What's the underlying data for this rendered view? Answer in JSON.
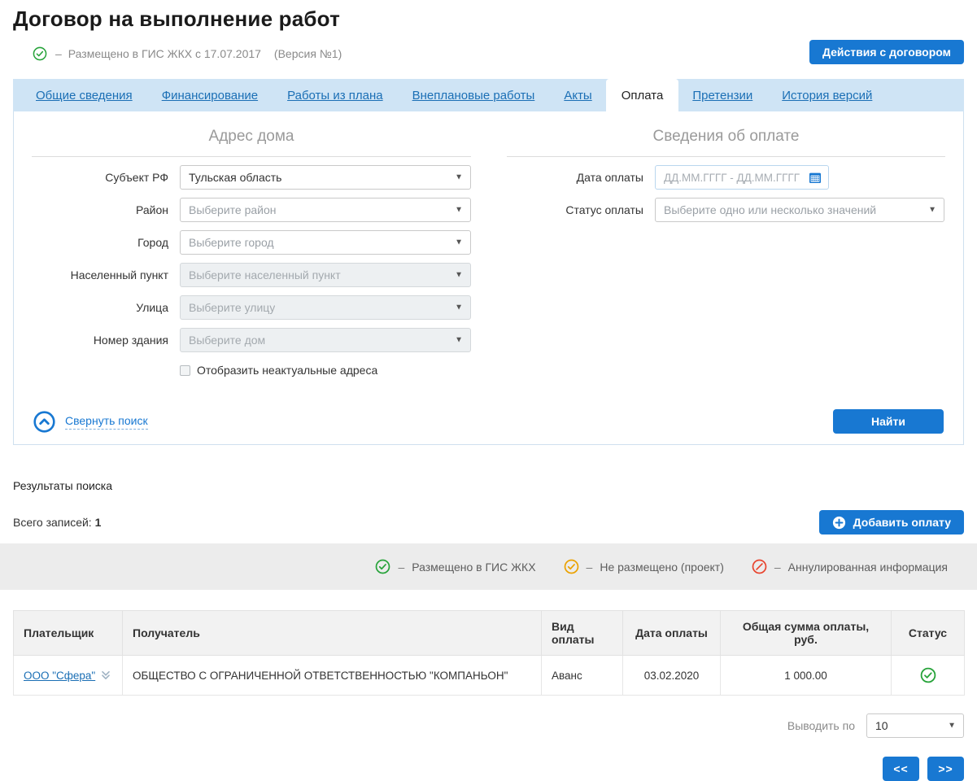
{
  "colors": {
    "accent": "#1878d2",
    "green": "#27a33a",
    "orange": "#eba200",
    "red": "#e8442e"
  },
  "page": {
    "title": "Договор на выполнение работ",
    "status_dash": "–",
    "status_text": "Размещено в ГИС ЖКХ с 17.07.2017",
    "version_text": "(Версия №1)",
    "actions_button": "Действия с договором"
  },
  "tabs": [
    {
      "label": "Общие сведения"
    },
    {
      "label": "Финансирование"
    },
    {
      "label": "Работы из плана"
    },
    {
      "label": "Внеплановые работы"
    },
    {
      "label": "Акты"
    },
    {
      "label": "Оплата",
      "active": true
    },
    {
      "label": "Претензии"
    },
    {
      "label": "История версий"
    }
  ],
  "search": {
    "address_section_title": "Адрес дома",
    "payment_section_title": "Сведения об оплате",
    "address_fields": [
      {
        "label": "Субъект РФ",
        "text": "Тульская область"
      },
      {
        "label": "Район",
        "text": "Выберите район"
      },
      {
        "label": "Город",
        "text": "Выберите город"
      },
      {
        "label": "Населенный пункт",
        "text": "Выберите населенный пункт"
      },
      {
        "label": "Улица",
        "text": "Выберите улицу"
      },
      {
        "label": "Номер здания",
        "text": "Выберите дом"
      }
    ],
    "checkbox_label": "Отобразить неактуальные адреса",
    "payment_date_label": "Дата оплаты",
    "payment_date_placeholder": "ДД.ММ.ГГГГ - ДД.ММ.ГГГГ",
    "payment_status_label": "Статус оплаты",
    "payment_status_placeholder": "Выберите одно или несколько значений",
    "collapse_link": "Свернуть поиск",
    "find_button": "Найти"
  },
  "results": {
    "title": "Результаты поиска",
    "total_label": "Всего записей:",
    "total_value": "1",
    "add_button": "Добавить оплату",
    "legend_dash": "–",
    "legend": [
      {
        "label": "Размещено в ГИС ЖКХ"
      },
      {
        "label": "Не размещено (проект)"
      },
      {
        "label": "Аннулированная информация"
      }
    ]
  },
  "table": {
    "headers": [
      "Плательщик",
      "Получатель",
      "Вид оплаты",
      "Дата оплаты",
      "Общая сумма оплаты, руб.",
      "Статус"
    ],
    "rows": [
      {
        "payer": "ООО \"Сфера\"",
        "recipient": "ОБЩЕСТВО С ОГРАНИЧЕННОЙ ОТВЕТСТВЕННОСТЬЮ \"КОМПАНЬОН\"",
        "payment_type": "Аванс",
        "payment_date": "03.02.2020",
        "total_amount": "1 000.00",
        "status": "Размещено в ГИС ЖКХ"
      }
    ]
  },
  "pagination": {
    "per_page_label": "Выводить по",
    "per_page_value": "10",
    "prev_label": "<<",
    "next_label": ">>"
  }
}
